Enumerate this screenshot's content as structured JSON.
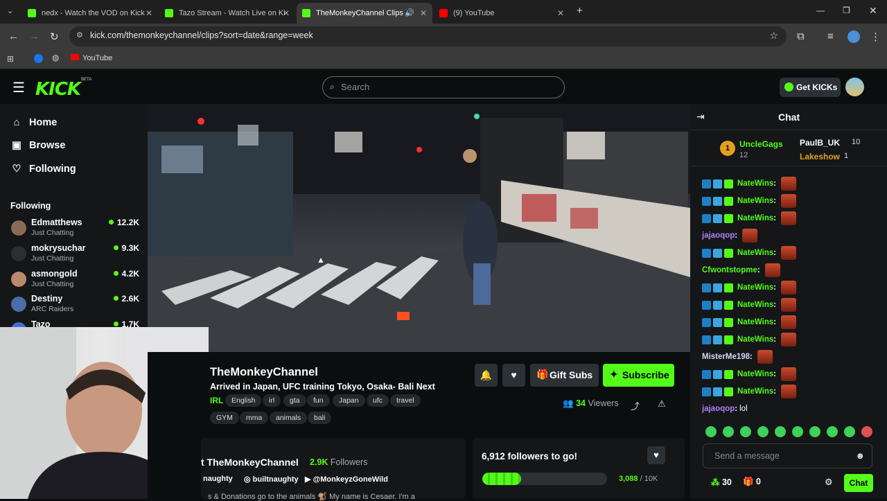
{
  "browser": {
    "tabs": [
      {
        "title": "nedx - Watch the VOD on Kick",
        "favicon_color": "#53fc18"
      },
      {
        "title": "Tazo Stream - Watch Live on Ki",
        "favicon_color": "#53fc18"
      },
      {
        "title": "TheMonkeyChannel Clips -",
        "favicon_color": "#53fc18",
        "active": true
      },
      {
        "title": "(9) YouTube",
        "favicon_color": "#ff0000"
      }
    ],
    "url": "kick.com/themonkeychannel/clips?sort=date&range=week",
    "bookmarks": [
      {
        "label": "YouTube"
      }
    ]
  },
  "header": {
    "logo": "KICK",
    "beta": "BETA",
    "search_placeholder": "Search",
    "get_kicks": "Get KICKs"
  },
  "sidebar": {
    "nav": [
      {
        "label": "Home",
        "icon": "home-icon"
      },
      {
        "label": "Browse",
        "icon": "browse-icon"
      },
      {
        "label": "Following",
        "icon": "heart-icon"
      }
    ],
    "following_heading": "Following",
    "following": [
      {
        "name": "Edmatthews",
        "category": "Just Chatting",
        "viewers": "12.2K"
      },
      {
        "name": "mokrysuchar",
        "category": "Just Chatting",
        "viewers": "9.3K"
      },
      {
        "name": "asmongold",
        "category": "Just Chatting",
        "viewers": "4.2K"
      },
      {
        "name": "Destiny",
        "category": "ARC Raiders",
        "viewers": "2.6K"
      },
      {
        "name": "Tazo",
        "category": "",
        "viewers": "1.7K"
      }
    ]
  },
  "stream": {
    "channel_name": "TheMonkeyChannel",
    "title": "Arrived in Japan, UFC training Tokyo, Osaka- Bali Next",
    "category": "IRL",
    "tags": [
      "English",
      "irl",
      "gta",
      "fun",
      "Japan",
      "ufc",
      "travel",
      "GYM",
      "mma",
      "animals",
      "bali"
    ],
    "gift_subs": "Gift Subs",
    "subscribe": "Subscribe",
    "viewers_count": "34",
    "viewers_label": "Viewers"
  },
  "about": {
    "name": "t TheMonkeyChannel",
    "followers": "2.9K",
    "followers_label": "Followers",
    "socials": [
      "naughty",
      "builtnaughty",
      "@MonkeyzGoneWild"
    ],
    "bio": "s & Donations go to the animals 🐒 My name is Cesaer. I'm a"
  },
  "goal": {
    "text": "6,912 followers to go!",
    "current": "3,088",
    "target": "10K",
    "progress": 0.3088
  },
  "chat": {
    "title": "Chat",
    "leaders": [
      {
        "name": "UncleGags",
        "count": "12"
      },
      {
        "name": "PaulB_UK",
        "count": "10"
      },
      {
        "name": "Lakeshow",
        "count": "1"
      }
    ],
    "messages": [
      {
        "user": "NateWins",
        "text": "",
        "color": "#53fc18"
      },
      {
        "user": "NateWins",
        "text": "",
        "color": "#53fc18"
      },
      {
        "user": "NateWins",
        "text": "",
        "color": "#53fc18"
      },
      {
        "user": "jajaoqop",
        "text": "",
        "color": "#b87cff"
      },
      {
        "user": "NateWins",
        "text": "",
        "color": "#53fc18"
      },
      {
        "user": "Cfwontstopme",
        "text": "",
        "color": "#53fc18"
      },
      {
        "user": "NateWins",
        "text": "",
        "color": "#53fc18"
      },
      {
        "user": "NateWins",
        "text": "",
        "color": "#53fc18"
      },
      {
        "user": "NateWins",
        "text": "",
        "color": "#53fc18"
      },
      {
        "user": "NateWins",
        "text": "",
        "color": "#53fc18"
      },
      {
        "user": "MisterMe198",
        "text": "",
        "color": "#d7d7ff"
      },
      {
        "user": "NateWins",
        "text": "",
        "color": "#53fc18"
      },
      {
        "user": "NateWins",
        "text": "",
        "color": "#53fc18"
      },
      {
        "user": "jajaoqop",
        "text": "lol",
        "color": "#b87cff"
      }
    ],
    "input_placeholder": "Send a message",
    "points": "30",
    "gifts": "0",
    "send_label": "Chat"
  },
  "accent": "#53fc18"
}
